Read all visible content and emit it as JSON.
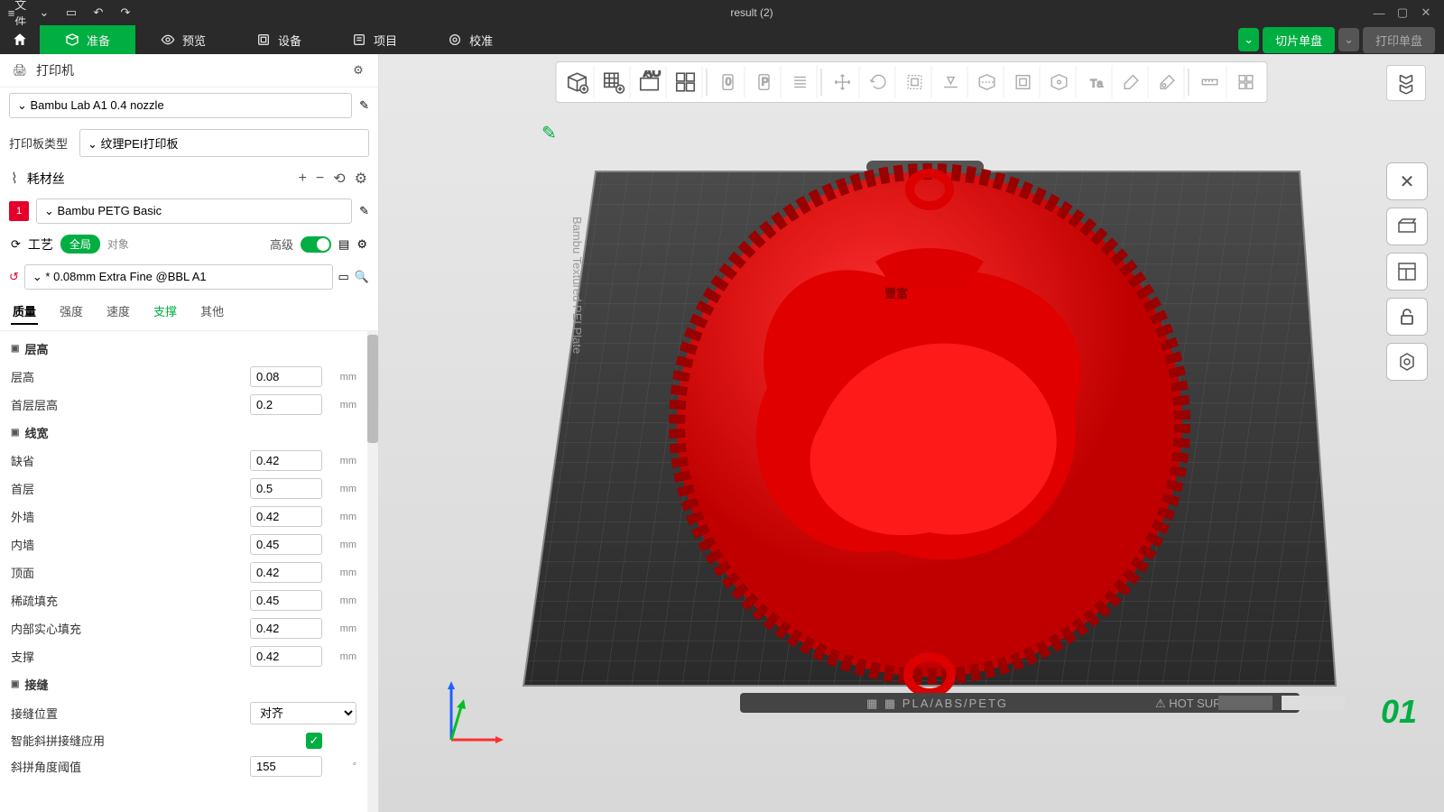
{
  "titlebar": {
    "file_menu": "文件",
    "title": "result (2)"
  },
  "menubar": {
    "prepare": "准备",
    "preview": "预览",
    "device": "设备",
    "project": "项目",
    "calibrate": "校准",
    "slice": "切片单盘",
    "print": "打印单盘"
  },
  "printer": {
    "section": "打印机",
    "preset": "Bambu Lab A1 0.4 nozzle",
    "plate_type_label": "打印板类型",
    "plate_type": "纹理PEI打印板"
  },
  "filament": {
    "section": "耗材丝",
    "items": [
      {
        "index": "1",
        "name": "Bambu PETG Basic",
        "color": "#e4002b"
      }
    ]
  },
  "process": {
    "section": "工艺",
    "global": "全局",
    "object": "对象",
    "advanced": "高级",
    "preset": "* 0.08mm Extra Fine @BBL A1"
  },
  "tabs": {
    "quality": "质量",
    "strength": "强度",
    "speed": "速度",
    "support": "支撑",
    "other": "其他"
  },
  "groups": {
    "layer_height": "层高",
    "line_width": "线宽",
    "seam": "接缝"
  },
  "params": {
    "layer_height": {
      "label": "层高",
      "value": "0.08",
      "unit": "mm"
    },
    "first_layer_height": {
      "label": "首层层高",
      "value": "0.2",
      "unit": "mm"
    },
    "default_lw": {
      "label": "缺省",
      "value": "0.42",
      "unit": "mm"
    },
    "first_layer_lw": {
      "label": "首层",
      "value": "0.5",
      "unit": "mm"
    },
    "outer_wall": {
      "label": "外墙",
      "value": "0.42",
      "unit": "mm"
    },
    "inner_wall": {
      "label": "内墙",
      "value": "0.45",
      "unit": "mm"
    },
    "top_surface": {
      "label": "顶面",
      "value": "0.42",
      "unit": "mm"
    },
    "sparse_infill": {
      "label": "稀疏填充",
      "value": "0.45",
      "unit": "mm"
    },
    "solid_infill": {
      "label": "内部实心填充",
      "value": "0.42",
      "unit": "mm"
    },
    "support_lw": {
      "label": "支撑",
      "value": "0.42",
      "unit": "mm"
    },
    "seam_position": {
      "label": "接缝位置",
      "value": "对齐"
    },
    "smart_scarf": {
      "label": "智能斜拼接缝应用"
    },
    "scarf_angle": {
      "label": "斜拼角度阈值",
      "value": "155",
      "unit": "°"
    }
  },
  "viewport": {
    "plate_number": "01",
    "plate_label": "PLA/ABS/PETG",
    "hot_surface": "HOT SURFACE",
    "plate_text": "Bambu Textured PEI Plate"
  }
}
